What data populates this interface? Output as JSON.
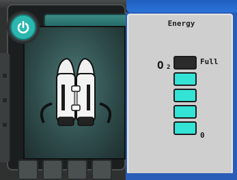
{
  "panel": {
    "title": "Energy",
    "resource_symbol": "O",
    "resource_subscript": "2",
    "max_label": "Full",
    "min_label": "0"
  },
  "gauge": {
    "total_cells": 5,
    "filled_cells": 4,
    "fill_color": "#33e3d6",
    "empty_color": "#2b2b2b"
  },
  "item": {
    "icon": "jetpack-icon"
  },
  "colors": {
    "accent_teal": "#2bb7b0",
    "frame_blue": "#2a5db7",
    "panel_grey": "#cfcfcf"
  }
}
